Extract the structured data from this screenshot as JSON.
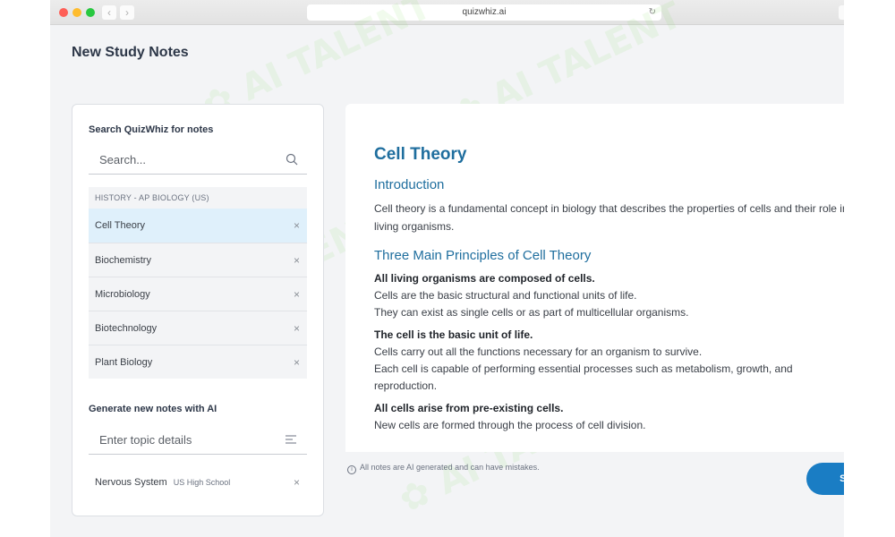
{
  "browser": {
    "url": "quizwhiz.ai",
    "back_icon": "chevron-left",
    "forward_icon": "chevron-right",
    "reload_icon": "reload"
  },
  "page": {
    "title": "New Study Notes"
  },
  "sidebar": {
    "search_label": "Search QuizWhiz for notes",
    "search_placeholder": "Search...",
    "search_value": "",
    "list_header": "HISTORY - AP BIOLOGY (US)",
    "notes": [
      {
        "label": "Cell Theory",
        "active": true
      },
      {
        "label": "Biochemistry",
        "active": false
      },
      {
        "label": "Microbiology",
        "active": false
      },
      {
        "label": "Biotechnology",
        "active": false
      },
      {
        "label": "Plant Biology",
        "active": false
      }
    ],
    "remove_glyph": "×",
    "generate_label": "Generate new notes with AI",
    "topic_placeholder": "Enter topic details",
    "topic_value": "",
    "generated": [
      {
        "label": "Nervous System",
        "level": "US High School"
      }
    ]
  },
  "document": {
    "title": "Cell Theory",
    "intro_heading": "Introduction",
    "intro_text": "Cell theory is a fundamental concept in biology that describes the properties of cells and their role in living organisms.",
    "principles_heading": "Three Main Principles of Cell Theory",
    "principles": [
      {
        "title": "All living organisms are composed of cells.",
        "lines": [
          "Cells are the basic structural and functional units of life.",
          "They can exist as single cells or as part of multicellular organisms."
        ]
      },
      {
        "title": "The cell is the basic unit of life.",
        "lines": [
          "Cells carry out all the functions necessary for an organism to survive.",
          "Each cell is capable of performing essential processes such as metabolism, growth, and reproduction."
        ]
      },
      {
        "title": "All cells arise from pre-existing cells.",
        "lines": [
          "New cells are formed through the process of cell division."
        ]
      }
    ]
  },
  "footer": {
    "disclaimer": "All notes are AI generated and can have mistakes.",
    "info_glyph": "i",
    "save_label": "Save"
  },
  "colors": {
    "accent": "#1a7dc4",
    "heading": "#1f6e9e",
    "active_item": "#dff0fb",
    "background": "#f3f4f6"
  }
}
